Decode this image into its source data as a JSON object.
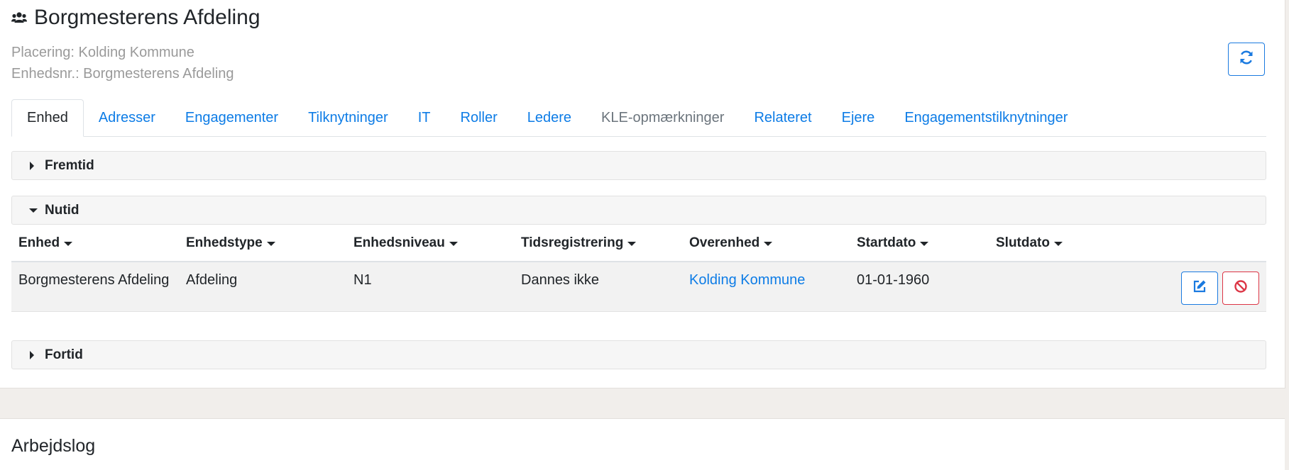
{
  "header": {
    "title": "Borgmesterens Afdeling",
    "placering": "Placering: Kolding Kommune",
    "enhedsnr": "Enhedsnr.: Borgmesterens Afdeling",
    "refresh_icon": "refresh-icon",
    "title_icon": "users-icon"
  },
  "tabs": [
    {
      "label": "Enhed",
      "state": "active"
    },
    {
      "label": "Adresser",
      "state": "link"
    },
    {
      "label": "Engagementer",
      "state": "link"
    },
    {
      "label": "Tilknytninger",
      "state": "link"
    },
    {
      "label": "IT",
      "state": "link"
    },
    {
      "label": "Roller",
      "state": "link"
    },
    {
      "label": "Ledere",
      "state": "link"
    },
    {
      "label": "KLE-opmærkninger",
      "state": "disabled"
    },
    {
      "label": "Relateret",
      "state": "link"
    },
    {
      "label": "Ejere",
      "state": "link"
    },
    {
      "label": "Engagementstilknytninger",
      "state": "link"
    }
  ],
  "sections": {
    "fremtid": {
      "label": "Fremtid",
      "expanded": false
    },
    "nutid": {
      "label": "Nutid",
      "expanded": true
    },
    "fortid": {
      "label": "Fortid",
      "expanded": false
    }
  },
  "table": {
    "columns": [
      "Enhed",
      "Enhedstype",
      "Enhedsniveau",
      "Tidsregistrering",
      "Overenhed",
      "Startdato",
      "Slutdato"
    ],
    "rows": [
      {
        "enhed": "Borgmesterens Afdeling",
        "enhedstype": "Afdeling",
        "enhedsniveau": "N1",
        "tidsregistrering": "Dannes ikke",
        "overenhed": "Kolding Kommune",
        "startdato": "01-01-1960",
        "slutdato": ""
      }
    ],
    "row_actions": {
      "edit_icon": "edit-icon",
      "delete_icon": "ban-icon"
    }
  },
  "worklog": {
    "title": "Arbejdslog"
  },
  "colors": {
    "accent": "#0d7ce6",
    "danger": "#dc3545",
    "muted": "#9a9a9a"
  }
}
